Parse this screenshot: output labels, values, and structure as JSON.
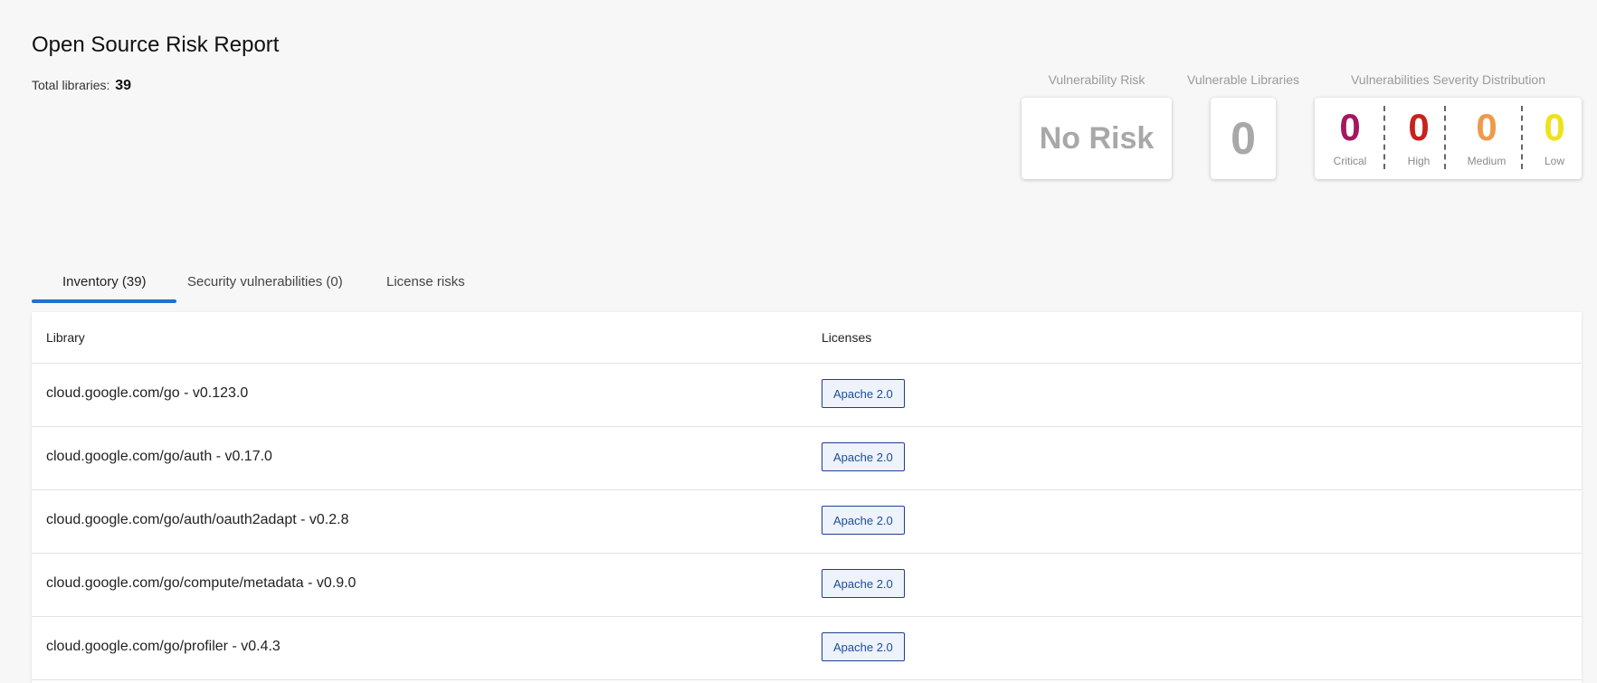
{
  "header": {
    "title": "Open Source Risk Report",
    "total_label": "Total libraries:",
    "total_value": "39"
  },
  "summary": {
    "risk": {
      "label": "Vulnerability Risk",
      "value": "No Risk"
    },
    "vulnerable": {
      "label": "Vulnerable Libraries",
      "value": "0"
    },
    "severity": {
      "label": "Vulnerabilities Severity Distribution",
      "items": [
        {
          "label": "Critical",
          "value": "0",
          "color": "#a3185f"
        },
        {
          "label": "High",
          "value": "0",
          "color": "#c8221c"
        },
        {
          "label": "Medium",
          "value": "0",
          "color": "#ee9a4a"
        },
        {
          "label": "Low",
          "value": "0",
          "color": "#eee21c"
        }
      ]
    }
  },
  "tabs": [
    {
      "label": "Inventory (39)",
      "active": true
    },
    {
      "label": "Security vulnerabilities (0)",
      "active": false
    },
    {
      "label": "License risks",
      "active": false
    }
  ],
  "table": {
    "columns": [
      "Library",
      "Licenses"
    ],
    "rows": [
      {
        "library": "cloud.google.com/go - v0.123.0",
        "license": "Apache 2.0"
      },
      {
        "library": "cloud.google.com/go/auth - v0.17.0",
        "license": "Apache 2.0"
      },
      {
        "library": "cloud.google.com/go/auth/oauth2adapt - v0.2.8",
        "license": "Apache 2.0"
      },
      {
        "library": "cloud.google.com/go/compute/metadata - v0.9.0",
        "license": "Apache 2.0"
      },
      {
        "library": "cloud.google.com/go/profiler - v0.4.3",
        "license": "Apache 2.0"
      }
    ]
  },
  "colors": {
    "accent": "#2270d3",
    "license_border": "#1e3f8f"
  }
}
